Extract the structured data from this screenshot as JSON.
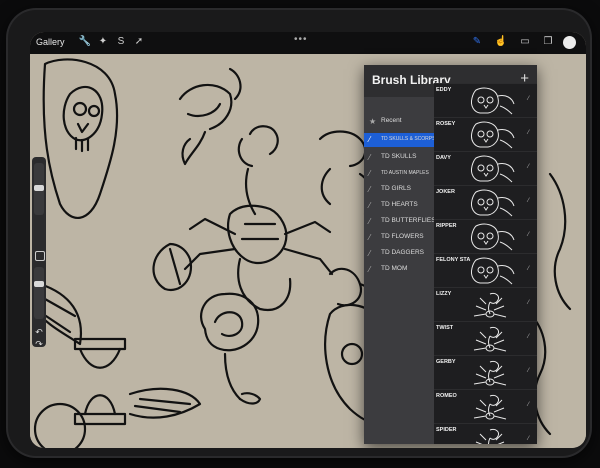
{
  "toolbar": {
    "gallery_label": "Gallery",
    "tools_left": [
      {
        "name": "wrench-icon",
        "glyph": "🔧"
      },
      {
        "name": "adjust-icon",
        "glyph": "✦"
      },
      {
        "name": "select-icon",
        "glyph": "S"
      },
      {
        "name": "transform-icon",
        "glyph": "➚"
      }
    ],
    "tools_right": [
      {
        "name": "brush-icon",
        "glyph": "✎"
      },
      {
        "name": "smudge-icon",
        "glyph": "☝"
      },
      {
        "name": "eraser-icon",
        "glyph": "▭"
      },
      {
        "name": "layers-icon",
        "glyph": "❐"
      }
    ],
    "more_dots": "•••",
    "active_tool": "brush",
    "color_swatch": "#ececec"
  },
  "sidebar": {
    "undo_glyph": "↶",
    "redo_glyph": "↷"
  },
  "brush_library": {
    "title": "Brush Library",
    "add_glyph": "+",
    "sets": [
      {
        "label": "Recent",
        "icon": "star-icon",
        "selected": false
      },
      {
        "label": "TD SKULLS & SCORPS",
        "icon": "brush-set-icon",
        "selected": true
      },
      {
        "label": "TD SKULLS",
        "icon": "brush-set-icon",
        "selected": false
      },
      {
        "label": "TD AUSTIN MAPLES",
        "icon": "brush-set-icon",
        "selected": false
      },
      {
        "label": "TD GIRLS",
        "icon": "brush-set-icon",
        "selected": false
      },
      {
        "label": "TD HEARTS",
        "icon": "brush-set-icon",
        "selected": false
      },
      {
        "label": "TD BUTTERFLIES",
        "icon": "brush-set-icon",
        "selected": false
      },
      {
        "label": "TD FLOWERS",
        "icon": "brush-set-icon",
        "selected": false
      },
      {
        "label": "TD DAGGERS",
        "icon": "brush-set-icon",
        "selected": false
      },
      {
        "label": "TD MOM",
        "icon": "brush-set-icon",
        "selected": false
      }
    ],
    "brushes": [
      {
        "name": "EDDY",
        "preview": "skull"
      },
      {
        "name": "ROSEY",
        "preview": "skull"
      },
      {
        "name": "DAVY",
        "preview": "skull"
      },
      {
        "name": "JOKER",
        "preview": "skull"
      },
      {
        "name": "RIPPER",
        "preview": "skull"
      },
      {
        "name": "FELONY STA",
        "preview": "skull"
      },
      {
        "name": "LIZZY",
        "preview": "scorpion"
      },
      {
        "name": "TWIST",
        "preview": "scorpion"
      },
      {
        "name": "GERBY",
        "preview": "scorpion"
      },
      {
        "name": "ROMEO",
        "preview": "scorpion"
      },
      {
        "name": "SPIDER",
        "preview": "scorpion"
      }
    ]
  },
  "colors": {
    "paper": "#bdb5a5",
    "ink": "#121212",
    "panel": "#2e2e30",
    "selected": "#1d5fd6"
  }
}
